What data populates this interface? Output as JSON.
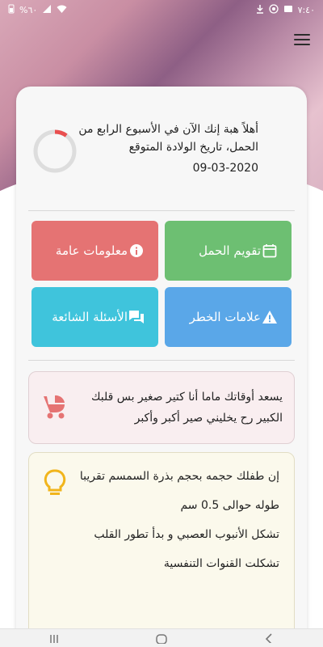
{
  "status_bar": {
    "battery_text": "%٦٠",
    "time": "٧:٤٠",
    "icons": [
      "battery-icon",
      "signal-icon",
      "wifi-icon",
      "download-icon",
      "whatsapp-icon",
      "message-icon"
    ]
  },
  "header": {
    "menu_icon": "hamburger-menu-icon"
  },
  "greeting": {
    "text": "أهلاً هبة إنك الآن في الأسبوع الرابع من الحمل، تاريخ الولادة المتوقع",
    "due_date": "09-03-2020",
    "progress_fraction": 0.1,
    "progress_color": "#e94f4f"
  },
  "tiles": [
    {
      "label": "تقويم الحمل",
      "icon": "calendar-icon",
      "color": "#6dbf72"
    },
    {
      "label": "معلومات عامة",
      "icon": "info-icon",
      "color": "#e57373"
    },
    {
      "label": "علامات الخطر",
      "icon": "warning-icon",
      "color": "#5aa7e8"
    },
    {
      "label": "الأسئلة الشائعة",
      "icon": "chat-icon",
      "color": "#3fc4dc"
    }
  ],
  "baby_message": {
    "text": "يسعد أوقاتك ماما أنا كتير صغير بس قلبك الكبير رح يخليني صير أكبر وأكبر",
    "icon": "stroller-icon"
  },
  "baby_info": {
    "icon": "lightbulb-icon",
    "items": [
      "إن طفلك حجمه بحجم بذرة السمسم تقريبا",
      "طوله حوالى 0.5 سم",
      "تشكل الأنبوب العصبي و بدأ تطور القلب",
      "تشكلت القنوات التنفسية"
    ]
  },
  "nav_bar": {
    "buttons": [
      "recent-apps-icon",
      "home-icon",
      "back-icon"
    ]
  }
}
